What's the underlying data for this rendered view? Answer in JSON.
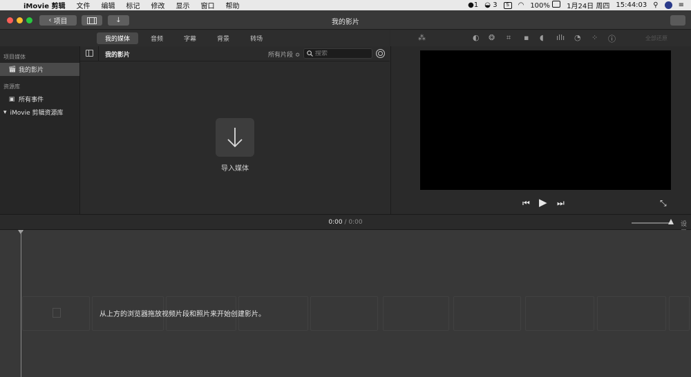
{
  "menubar": {
    "app_name": "iMovie 剪辑",
    "items": [
      "文件",
      "编辑",
      "标记",
      "修改",
      "显示",
      "窗口",
      "帮助"
    ],
    "qq_count": "1",
    "wechat_count": "3",
    "battery": "100%",
    "date": "1月24日 周四",
    "time": "15:44:03"
  },
  "toolbar": {
    "back_label": "项目",
    "window_title": "我的影片"
  },
  "browser_tabs": [
    "我的媒体",
    "音频",
    "字幕",
    "背景",
    "转场"
  ],
  "sidebar": {
    "project_section": "项目媒体",
    "project_item": "我的影片",
    "library_section": "资源库",
    "all_events": "所有事件",
    "library_name": "iMovie 剪辑资源库"
  },
  "browser": {
    "title": "我的影片",
    "filter": "所有片段 ≎",
    "search_placeholder": "搜索",
    "import_label": "导入媒体"
  },
  "viewer": {
    "reset_all": "全部还原"
  },
  "timeline": {
    "current_time": "0:00",
    "separator": "/",
    "total_time": "0:00",
    "settings_label": "设置",
    "hint": "从上方的浏览器拖放视频片段和照片来开始创建影片。"
  }
}
